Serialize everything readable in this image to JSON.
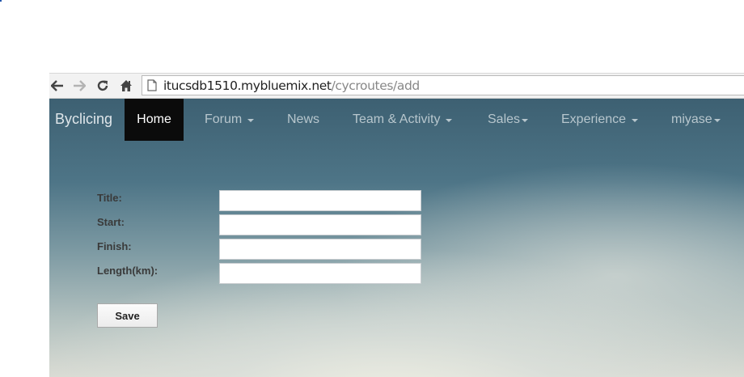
{
  "browser": {
    "url_host": "itucsdb1510.mybluemix.net",
    "url_path": "/cycroutes/add",
    "icons": [
      "back-icon",
      "forward-icon",
      "reload-icon",
      "home-icon",
      "page-icon"
    ]
  },
  "navbar": {
    "brand": "Byclicing",
    "items": [
      {
        "label": "Home",
        "active": true,
        "dropdown": false
      },
      {
        "label": "Forum",
        "active": false,
        "dropdown": true
      },
      {
        "label": "News",
        "active": false,
        "dropdown": false
      },
      {
        "label": "Team & Activity",
        "active": false,
        "dropdown": true
      },
      {
        "label": "Sales",
        "active": false,
        "dropdown": true
      },
      {
        "label": "Experience",
        "active": false,
        "dropdown": true
      },
      {
        "label": "miyase",
        "active": false,
        "dropdown": true
      }
    ]
  },
  "form": {
    "fields": [
      {
        "label": "Title:",
        "value": "",
        "placeholder": ""
      },
      {
        "label": "Start:",
        "value": "",
        "placeholder": ""
      },
      {
        "label": "Finish:",
        "value": "",
        "placeholder": ""
      },
      {
        "label": "Length(km):",
        "value": "",
        "placeholder": ""
      }
    ],
    "save_label": "Save"
  },
  "colors": {
    "active_nav_bg": "#0b0b0b",
    "nav_text": "#b7c6cd",
    "active_nav_text": "#ffffff"
  }
}
